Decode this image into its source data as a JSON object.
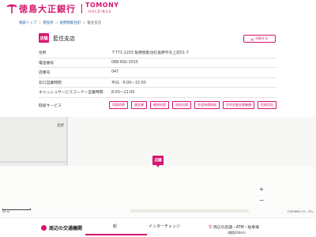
{
  "header": {
    "logo_jp": "徳島大正銀行",
    "logo_en": "TOMONY",
    "logo_en_sub": "HOLDINGS",
    "brand_color": "#d6166e"
  },
  "breadcrumb": {
    "items": [
      "検索トップ",
      "徳島県",
      "板野郡藍住町",
      "藍住支店"
    ]
  },
  "store": {
    "badge": "店舗",
    "name": "藍住支店",
    "print_label": "印刷する"
  },
  "info": {
    "rows": [
      {
        "label": "住所",
        "value": "〒771-1203 板野郡藍住町奥野字矢上前51-7"
      },
      {
        "label": "電話番号",
        "value": "088-692-3015"
      },
      {
        "label": "店番号",
        "value": "047"
      },
      {
        "label": "窓口営業時間",
        "value": "平日：9:00～15:00"
      },
      {
        "label": "キャッシュサービスコーナー営業時間",
        "value": "8:00～21:00"
      }
    ],
    "services_label": "取扱サービス",
    "services": [
      "両替両替",
      "貸金庫",
      "硬貨処理",
      "現金処理",
      "外国為替取扱",
      "住宅金融支援機構",
      "投資信託"
    ]
  },
  "map": {
    "labels": [
      "奥野",
      "店舗"
    ],
    "scale": "50 m",
    "copyright": "©ZENRIN CO., LTD."
  },
  "bottom": {
    "title": "周辺の交通機関",
    "tabs": [
      "駅",
      "インターチェンジ"
    ],
    "near_title": "周辺の店舗・ATM・駐車場",
    "near_sub": "（周囲10km）"
  }
}
